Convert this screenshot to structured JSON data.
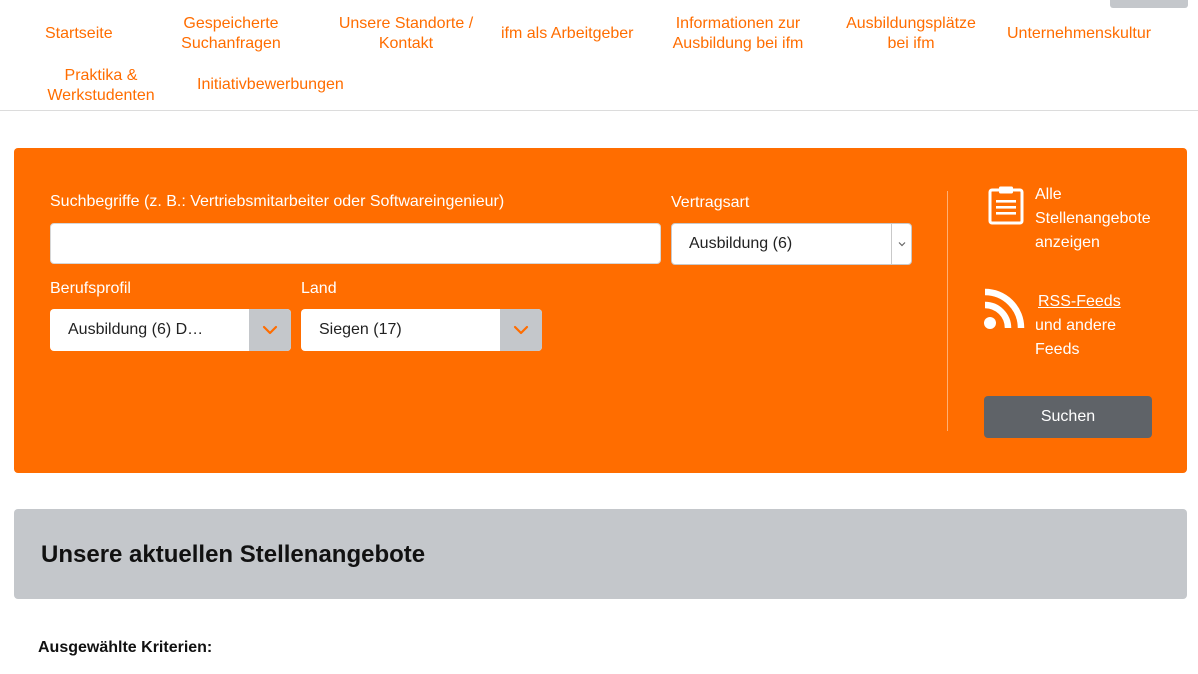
{
  "nav": {
    "items": [
      {
        "label": "Startseite"
      },
      {
        "label": "Gespeicherte\nSuchanfragen"
      },
      {
        "label": "Unsere Standorte /\nKontakt"
      },
      {
        "label": "ifm als Arbeitgeber"
      },
      {
        "label": "Informationen zur\nAusbildung bei ifm"
      },
      {
        "label": "Ausbildungsplätze\nbei ifm"
      },
      {
        "label": "Unternehmenskultur"
      },
      {
        "label": "Praktika &\nWerkstudenten"
      },
      {
        "label": "Initiativbewerbungen"
      }
    ]
  },
  "search": {
    "keywords_label": "Suchbegriffe (z. B.: Vertriebsmitarbeiter oder Softwareingenieur)",
    "keywords_value": "",
    "contract_label": "Vertragsart",
    "contract_value": "Ausbildung (6)",
    "profile_label": "Berufsprofil",
    "profile_value": "Ausbildung (6) D…",
    "country_label": "Land",
    "country_value": "Siegen (17)",
    "all_jobs_link": "Alle\nStellenangebote\nanzeigen",
    "rss_link": "RSS-Feeds",
    "rss_suffix": "und andere\nFeeds",
    "submit_label": "Suchen"
  },
  "results": {
    "title": "Unsere aktuellen Stellenangebote",
    "criteria_label": "Ausgewählte Kriterien:"
  },
  "colors": {
    "accent": "#ff6d00",
    "panel_grey": "#c4c7cb",
    "button_dark": "#5f6368"
  },
  "icons": {
    "all_jobs": "clipboard-list-icon",
    "rss": "rss-feed-icon",
    "select_arrow": "chevron-down-icon"
  }
}
